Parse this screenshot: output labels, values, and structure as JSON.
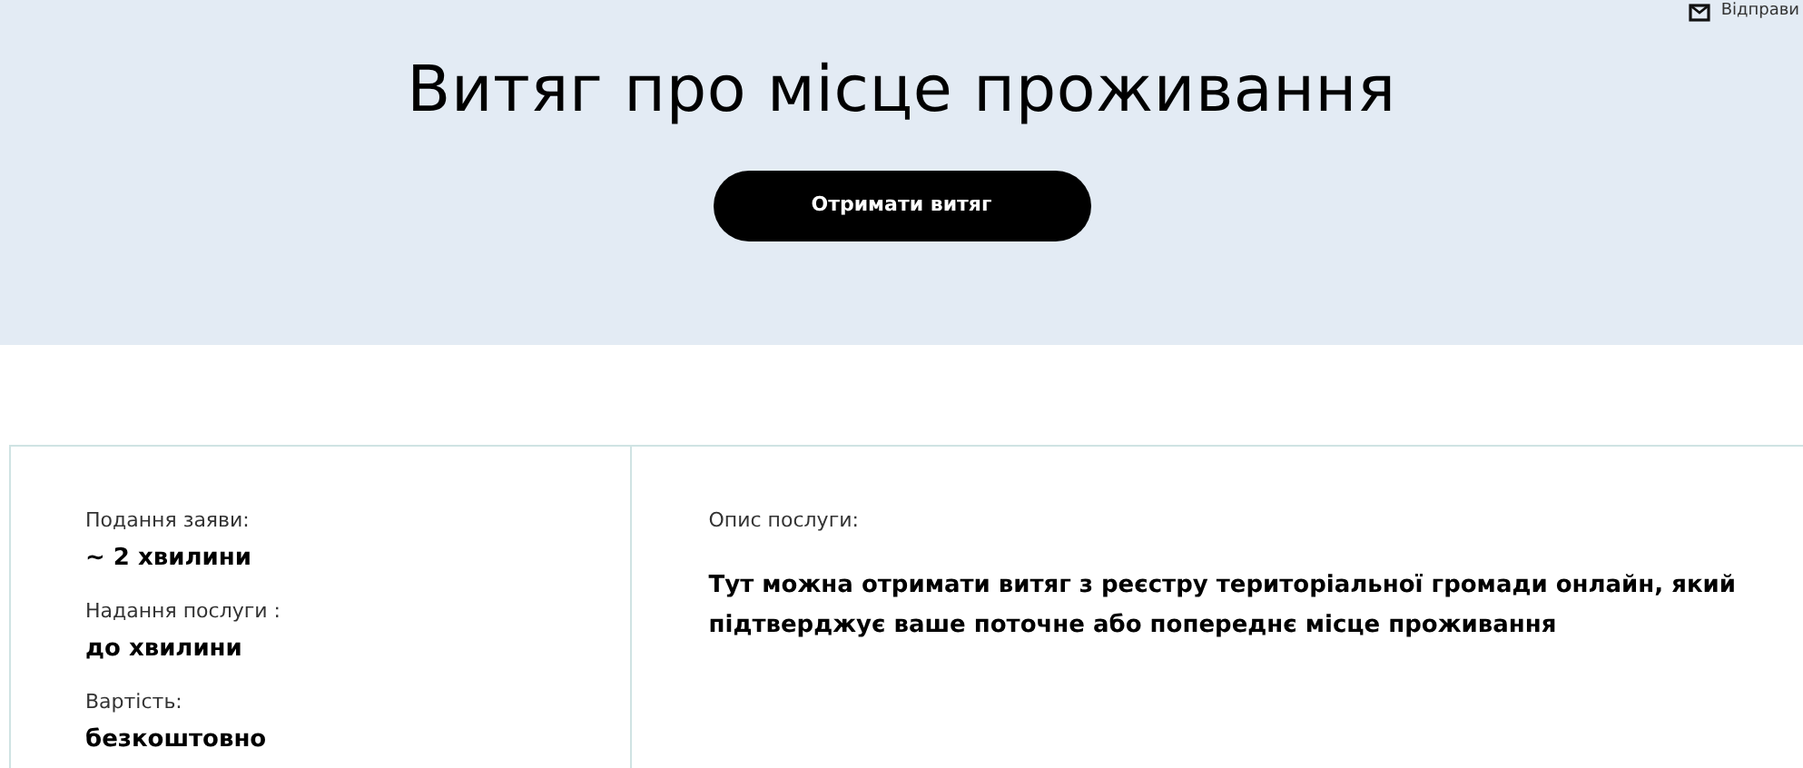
{
  "header": {
    "send_link": "Відправи",
    "title": "Витяг про місце проживання",
    "button": "Отримати витяг"
  },
  "details": [
    {
      "label": "Подання заяви:",
      "value": "~ 2 хвилини"
    },
    {
      "label": "Надання послуги :",
      "value": "до хвилини"
    },
    {
      "label": "Вартість:",
      "value": "безкоштовно"
    }
  ],
  "description": {
    "label": "Опис послуги:",
    "text": "Тут можна отримати витяг з реєстру територіальної громади онлайн, який підтверджує ваше поточне або попереднє місце проживання"
  }
}
